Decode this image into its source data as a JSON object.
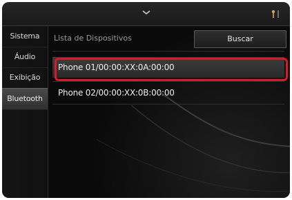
{
  "header": {
    "chevron_icon": "chevron-down-icon",
    "status_icon": "status-indicator-icon"
  },
  "sidebar": {
    "items": [
      {
        "label": "Sistema",
        "active": false
      },
      {
        "label": "Áudio",
        "active": false
      },
      {
        "label": "Exibição",
        "active": false
      },
      {
        "label": "Bluetooth",
        "active": true
      }
    ]
  },
  "main": {
    "list_header": "Lista de Dispositivos",
    "search_label": "Buscar",
    "devices": [
      {
        "label": "Phone 01/00:00:XX:0A:00:00",
        "selected": true
      },
      {
        "label": "Phone 02/00:00:XX:0B:00:00",
        "selected": false
      }
    ]
  },
  "colors": {
    "highlight": "#d91a2a",
    "background": "#0b0b0b",
    "text": "#f0f0f0"
  }
}
